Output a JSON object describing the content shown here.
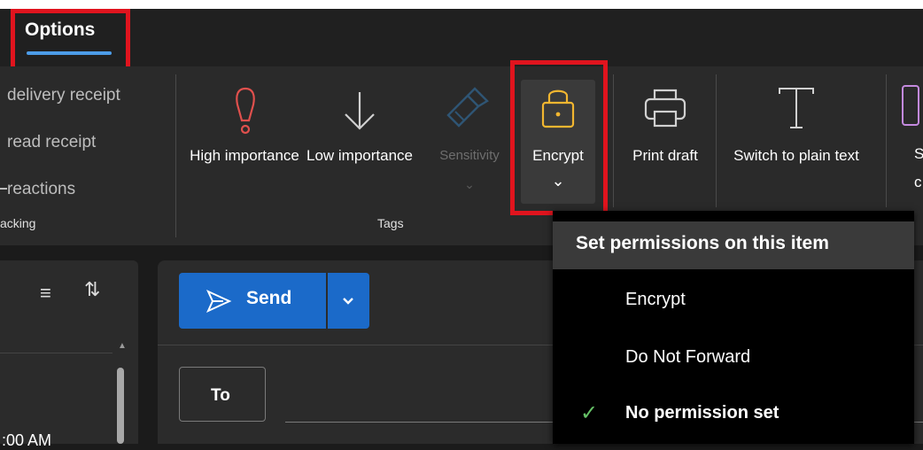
{
  "tabs": {
    "options": "Options"
  },
  "ribbon": {
    "tracking": {
      "delivery_receipt": "delivery receipt",
      "read_receipt": "read receipt",
      "reactions": "reactions",
      "group_label": "acking"
    },
    "tags": {
      "high_importance": "High importance",
      "low_importance": "Low importance",
      "sensitivity": "Sensitivity",
      "encrypt": "Encrypt",
      "group_label": "Tags"
    },
    "print_draft": "Print draft",
    "switch_plain": "Switch to plain text",
    "partial_label_top": "S",
    "partial_label_bottom": "c"
  },
  "compose": {
    "send_label": "Send",
    "to_label": "To",
    "time_partial": ":00 AM"
  },
  "menu": {
    "header": "Set permissions on this item",
    "items": [
      "Encrypt",
      "Do Not Forward",
      "No permission set"
    ],
    "checked_index": 2
  },
  "colors": {
    "accent": "#1b6ac9",
    "highlight": "#e0141e",
    "high_importance": "#e0504d",
    "encrypt": "#f2b630",
    "check": "#66c267"
  }
}
